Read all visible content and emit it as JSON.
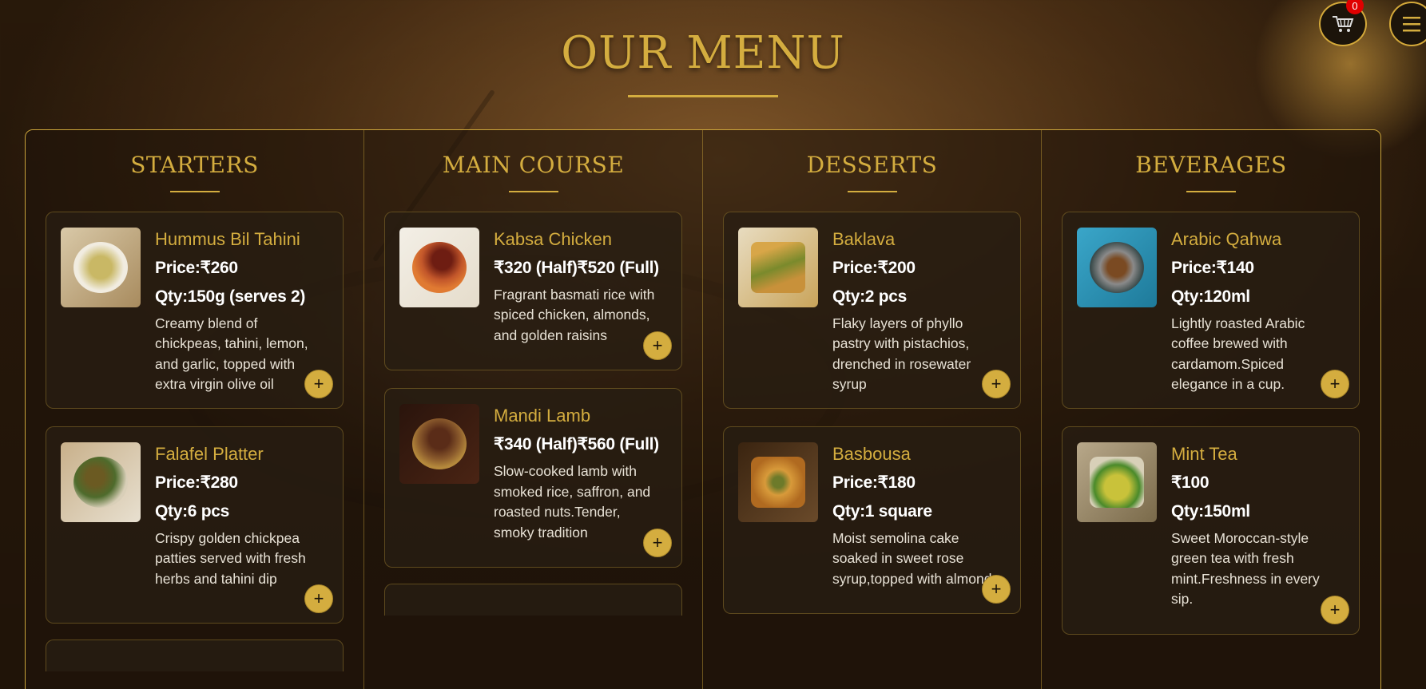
{
  "header": {
    "title": "OUR MENU",
    "cart_count": "0",
    "cart_icon": "cart-icon",
    "menu_icon": "hamburger-icon"
  },
  "colors": {
    "accent": "#d4ad3f",
    "badge": "#e00000"
  },
  "categories": [
    {
      "name": "STARTERS",
      "items": [
        {
          "name": "Hummus Bil Tahini",
          "price": "Price:₹260",
          "qty": "Qty:150g (serves 2)",
          "desc": "Creamy blend of chickpeas, tahini, lemon, and garlic, topped with extra virgin olive oil",
          "add": "+"
        },
        {
          "name": "Falafel Platter",
          "price": "Price:₹280",
          "qty": "Qty:6 pcs",
          "desc": "Crispy golden chickpea patties served with fresh herbs and tahini dip",
          "add": "+"
        }
      ]
    },
    {
      "name": "MAIN COURSE",
      "items": [
        {
          "name": "Kabsa Chicken",
          "price": "₹320 (Half)₹520 (Full)",
          "desc": "Fragrant basmati rice with spiced chicken, almonds, and golden raisins",
          "add": "+"
        },
        {
          "name": "Mandi Lamb",
          "price": "₹340 (Half)₹560 (Full)",
          "desc": "Slow-cooked lamb with smoked rice, saffron, and roasted nuts.Tender, smoky tradition",
          "add": "+"
        }
      ]
    },
    {
      "name": "DESSERTS",
      "items": [
        {
          "name": "Baklava",
          "price": "Price:₹200",
          "qty": "Qty:2 pcs",
          "desc": "Flaky layers of phyllo pastry with pistachios, drenched in rosewater syrup",
          "add": "+"
        },
        {
          "name": "Basbousa",
          "price": "Price:₹180",
          "qty": "Qty:1 square",
          "desc": "Moist semolina cake soaked in sweet rose syrup,topped with almonds",
          "add": "+"
        }
      ]
    },
    {
      "name": "BEVERAGES",
      "items": [
        {
          "name": "Arabic Qahwa",
          "price": "Price:₹140",
          "qty": "Qty:120ml",
          "desc": "Lightly roasted Arabic coffee brewed with cardamom.Spiced elegance in a cup.",
          "add": "+"
        },
        {
          "name": "Mint Tea",
          "price": "₹100",
          "qty": "Qty:150ml",
          "desc": "Sweet Moroccan-style green tea with fresh mint.Freshness in every sip.",
          "add": "+"
        }
      ]
    }
  ]
}
